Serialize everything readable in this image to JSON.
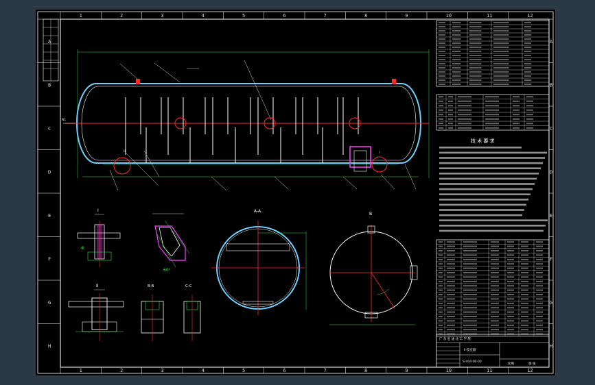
{
  "drawing": {
    "column_numbers": [
      "1",
      "2",
      "3",
      "4",
      "5",
      "6",
      "7",
      "8",
      "9",
      "10",
      "11",
      "12"
    ],
    "row_letters": [
      "A",
      "B",
      "C",
      "D",
      "E",
      "F",
      "G",
      "H"
    ],
    "views": {
      "detail_1": "I",
      "detail_2": "II",
      "section_aa": "A-A",
      "section_bb": "B-B",
      "section_cc": "C-C",
      "top_right_view": "B"
    },
    "tech_title": "技 术 要 求",
    "title_block": {
      "company": "广 东 石 油 化 工 学 院",
      "product": "Ⅱ-反应器",
      "drawing_no": "S-404-00-00",
      "scale": "比例",
      "sheet": "第 张"
    },
    "colors": {
      "background": "#000000",
      "border": "#ffffff",
      "vessel_outline": "#6fd0ff",
      "center_line": "#ff2a2a",
      "dimension": "#31e24a",
      "leader": "#d8d8d8",
      "magenta": "#ff40ff"
    }
  }
}
